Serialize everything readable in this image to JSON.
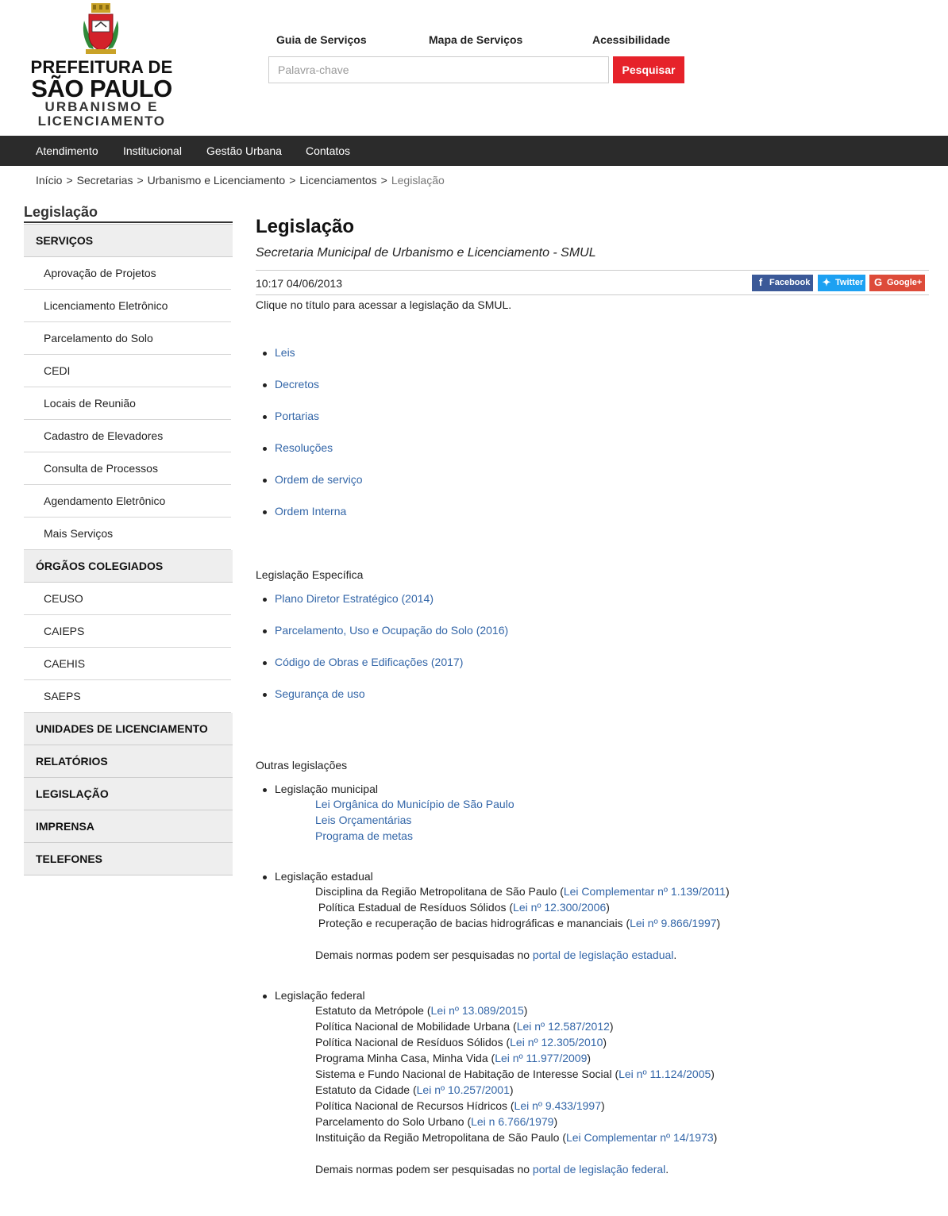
{
  "header": {
    "logo": {
      "line1": "PREFEITURA DE",
      "line2": "SÃO PAULO",
      "line3": "URBANISMO E",
      "line4": "LICENCIAMENTO"
    },
    "top_links": [
      "Guia de Serviços",
      "Mapa de Serviços",
      "Acessibilidade"
    ],
    "search": {
      "placeholder": "Palavra-chave",
      "value": "",
      "button_label": "Pesquisar"
    }
  },
  "nav": {
    "items": [
      "Atendimento",
      "Institucional",
      "Gestão Urbana",
      "Contatos"
    ]
  },
  "breadcrumb": {
    "items": [
      "Início",
      "Secretarias",
      "Urbanismo e Licenciamento",
      "Licenciamentos"
    ],
    "current": "Legislação",
    "separator": ">"
  },
  "sidebar": {
    "title": "Legislação",
    "categories": [
      {
        "label": "SERVIÇOS",
        "items": [
          "Aprovação de Projetos",
          "Licenciamento Eletrônico",
          "Parcelamento do Solo",
          "CEDI",
          "Locais de Reunião",
          "Cadastro de Elevadores",
          "Consulta de Processos",
          "Agendamento Eletrônico",
          "Mais Serviços"
        ]
      },
      {
        "label": "ÓRGÃOS COLEGIADOS",
        "items": [
          "CEUSO",
          "CAIEPS",
          "CAEHIS",
          "SAEPS"
        ]
      },
      {
        "label": "UNIDADES DE LICENCIAMENTO",
        "items": []
      },
      {
        "label": "RELATÓRIOS",
        "items": []
      },
      {
        "label": "LEGISLAÇÃO",
        "items": []
      },
      {
        "label": "IMPRENSA",
        "items": []
      },
      {
        "label": "TELEFONES",
        "items": []
      }
    ]
  },
  "main": {
    "title": "Legislação",
    "subtitle": "Secretaria Municipal de Urbanismo e Licenciamento - SMUL",
    "date": "10:17 04/06/2013",
    "share": {
      "facebook": "Facebook",
      "twitter": "Twitter",
      "google": "Google+"
    },
    "intro": "Clique no título para acessar a legislação da SMUL.",
    "main_links": [
      "Leis",
      "Decretos",
      "Portarias",
      "Resoluções",
      "Ordem de serviço",
      "Ordem Interna"
    ],
    "especifica": {
      "label": "Legislação Específica",
      "links": [
        "Plano Diretor Estratégico (2014)",
        "Parcelamento, Uso e Ocupação do Solo (2016)",
        "Código de Obras e Edificações (2017)",
        "Segurança de uso"
      ]
    },
    "outras": {
      "label": "Outras legislações",
      "municipal": {
        "label": "Legislação municipal",
        "links": [
          "Lei Orgânica do Município de São Paulo",
          "Leis Orçamentárias",
          "Programa de metas"
        ]
      },
      "estadual": {
        "label": "Legislação estadual",
        "rows": [
          {
            "text": "Disciplina da Região Metropolitana de São Paulo (",
            "link": "Lei Complementar nº 1.139/2011",
            "tail": ")"
          },
          {
            "text": " Política Estadual de Resíduos Sólidos (",
            "link": "Lei nº 12.300/2006",
            "tail": ")"
          },
          {
            "text": " Proteção e recuperação de bacias hidrográficas e mananciais (",
            "link": "Lei nº 9.866/1997",
            "tail": ")"
          }
        ],
        "more_text": "Demais normas podem ser pesquisadas no ",
        "more_link": "portal de legislação estadual",
        "more_tail": "."
      },
      "federal": {
        "label": "Legislação federal",
        "rows": [
          {
            "text": "Estatuto da Metrópole (",
            "link": "Lei nº 13.089/2015",
            "tail": ")"
          },
          {
            "text": "Política Nacional de Mobilidade Urbana (",
            "link": "Lei nº 12.587/2012",
            "tail": ")"
          },
          {
            "text": "Política Nacional de Resíduos Sólidos (",
            "link": "Lei nº 12.305/2010",
            "tail": ")"
          },
          {
            "text": "Programa Minha Casa, Minha Vida (",
            "link": "Lei nº 11.977/2009",
            "tail": ")"
          },
          {
            "text": "Sistema e Fundo Nacional de Habitação de Interesse Social (",
            "link": "Lei nº 11.124/2005",
            "tail": ")"
          },
          {
            "text": "Estatuto da Cidade (",
            "link": "Lei nº 10.257/2001",
            "tail": ")"
          },
          {
            "text": "Política Nacional de Recursos Hídricos (",
            "link": "Lei nº 9.433/1997",
            "tail": ")"
          },
          {
            "text": "Parcelamento do Solo Urbano (",
            "link": "Lei n 6.766/1979",
            "tail": ")"
          },
          {
            "text": "Instituição da Região Metropolitana de São Paulo (",
            "link": "Lei Complementar nº 14/1973",
            "tail": ")"
          }
        ],
        "more_text": "Demais normas podem ser pesquisadas no ",
        "more_link": "portal de legislação federal",
        "more_tail": "."
      }
    }
  },
  "colors": {
    "accent_red": "#e6222a",
    "nav_bg": "#2b2b2b",
    "link": "#3366a8",
    "facebook": "#3b5998",
    "twitter": "#1da1f2",
    "google": "#dd4b39"
  }
}
